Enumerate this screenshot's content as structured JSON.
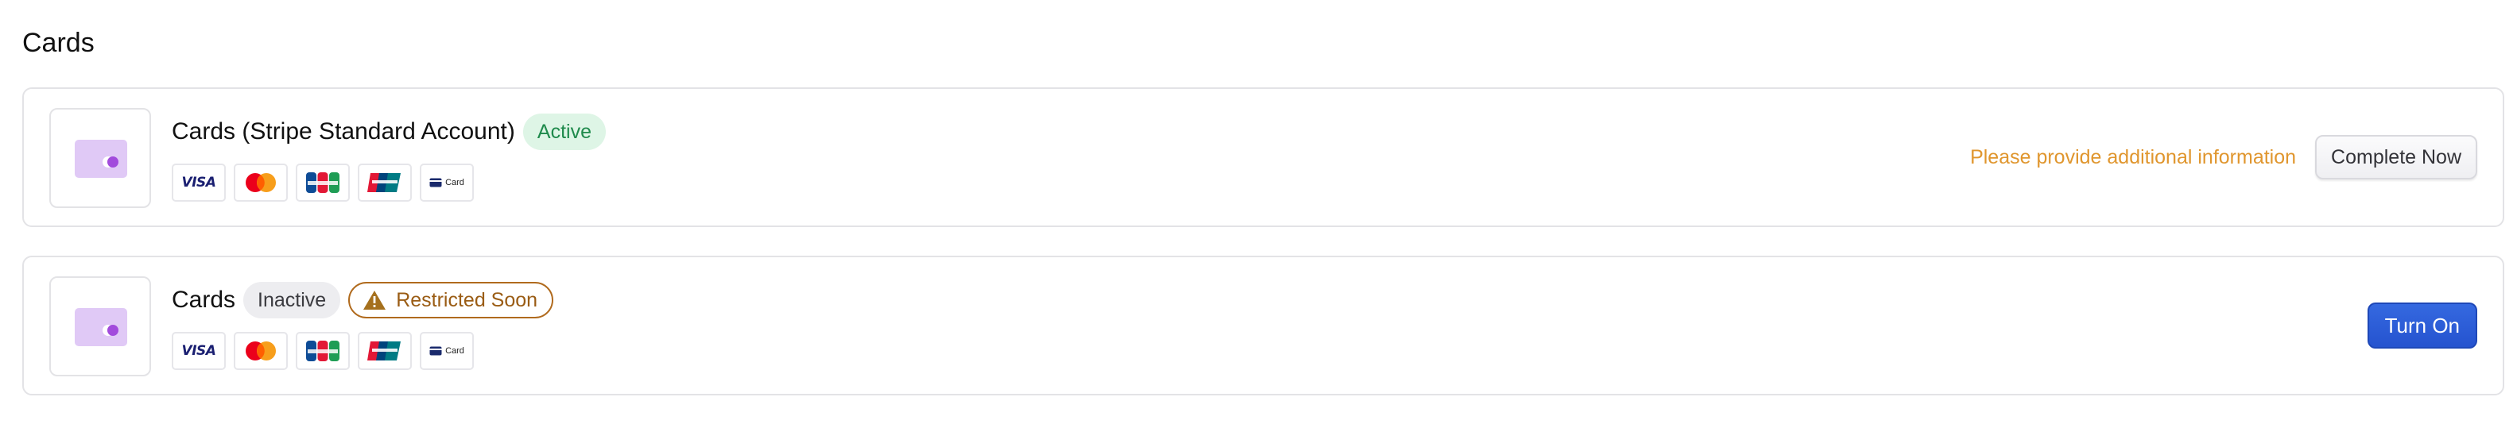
{
  "section": {
    "title": "Cards"
  },
  "logo_labels": {
    "generic": "Card"
  },
  "colors": {
    "active_badge_bg": "#def5e6",
    "active_badge_text": "#1f8a4c",
    "restricted_border": "#b06a1d",
    "info_text": "#e0962e",
    "primary_button": "#2d5fd8",
    "card_icon": "#dcc4f4"
  },
  "rows": [
    {
      "title": "Cards (Stripe Standard Account)",
      "status_badge": "Active",
      "logos": [
        "visa-icon",
        "mastercard-icon",
        "jcb-icon",
        "unionpay-icon",
        "generic-card-icon"
      ],
      "info_text": "Please provide additional information",
      "action_label": "Complete Now"
    },
    {
      "title": "Cards",
      "status_badge": "Inactive",
      "warning_badge": "Restricted Soon",
      "logos": [
        "visa-icon",
        "mastercard-icon",
        "jcb-icon",
        "unionpay-icon",
        "generic-card-icon"
      ],
      "action_label": "Turn On"
    }
  ]
}
